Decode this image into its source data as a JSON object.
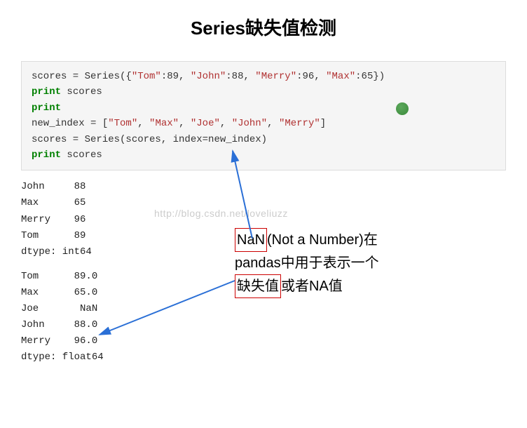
{
  "title": "Series缺失值检测",
  "code": {
    "line1_a": "scores = Series({",
    "line1_tom_k": "\"Tom\"",
    "line1_tom_v": ":89, ",
    "line1_john_k": "\"John\"",
    "line1_john_v": ":88, ",
    "line1_merry_k": "\"Merry\"",
    "line1_merry_v": ":96, ",
    "line1_max_k": "\"Max\"",
    "line1_max_v": ":65})",
    "line2_kw": "print",
    "line2_rest": " scores",
    "line3_kw": "print",
    "line4_a": "new_index = [",
    "line4_tom": "\"Tom\"",
    "line4_c1": ", ",
    "line4_max": "\"Max\"",
    "line4_c2": ", ",
    "line4_joe": "\"Joe\"",
    "line4_c3": ", ",
    "line4_john": "\"John\"",
    "line4_c4": ", ",
    "line4_merry": "\"Merry\"",
    "line4_end": "]",
    "line5": "scores = Series(scores, index=new_index)",
    "line6_kw": "print",
    "line6_rest": " scores"
  },
  "output1": "John     88\nMax      65\nMerry    96\nTom      89\ndtype: int64",
  "output2": "Tom      89.0\nMax      65.0\nJoe       NaN\nJohn     88.0\nMerry    96.0\ndtype: float64",
  "annotation": {
    "nan": "NaN",
    "part1": "(Not a Number)在",
    "part2": "pandas中用于表示一个",
    "missing": "缺失值",
    "part3": "或者NA值"
  },
  "watermark": "http://blog.csdn.net/loveliuzz"
}
